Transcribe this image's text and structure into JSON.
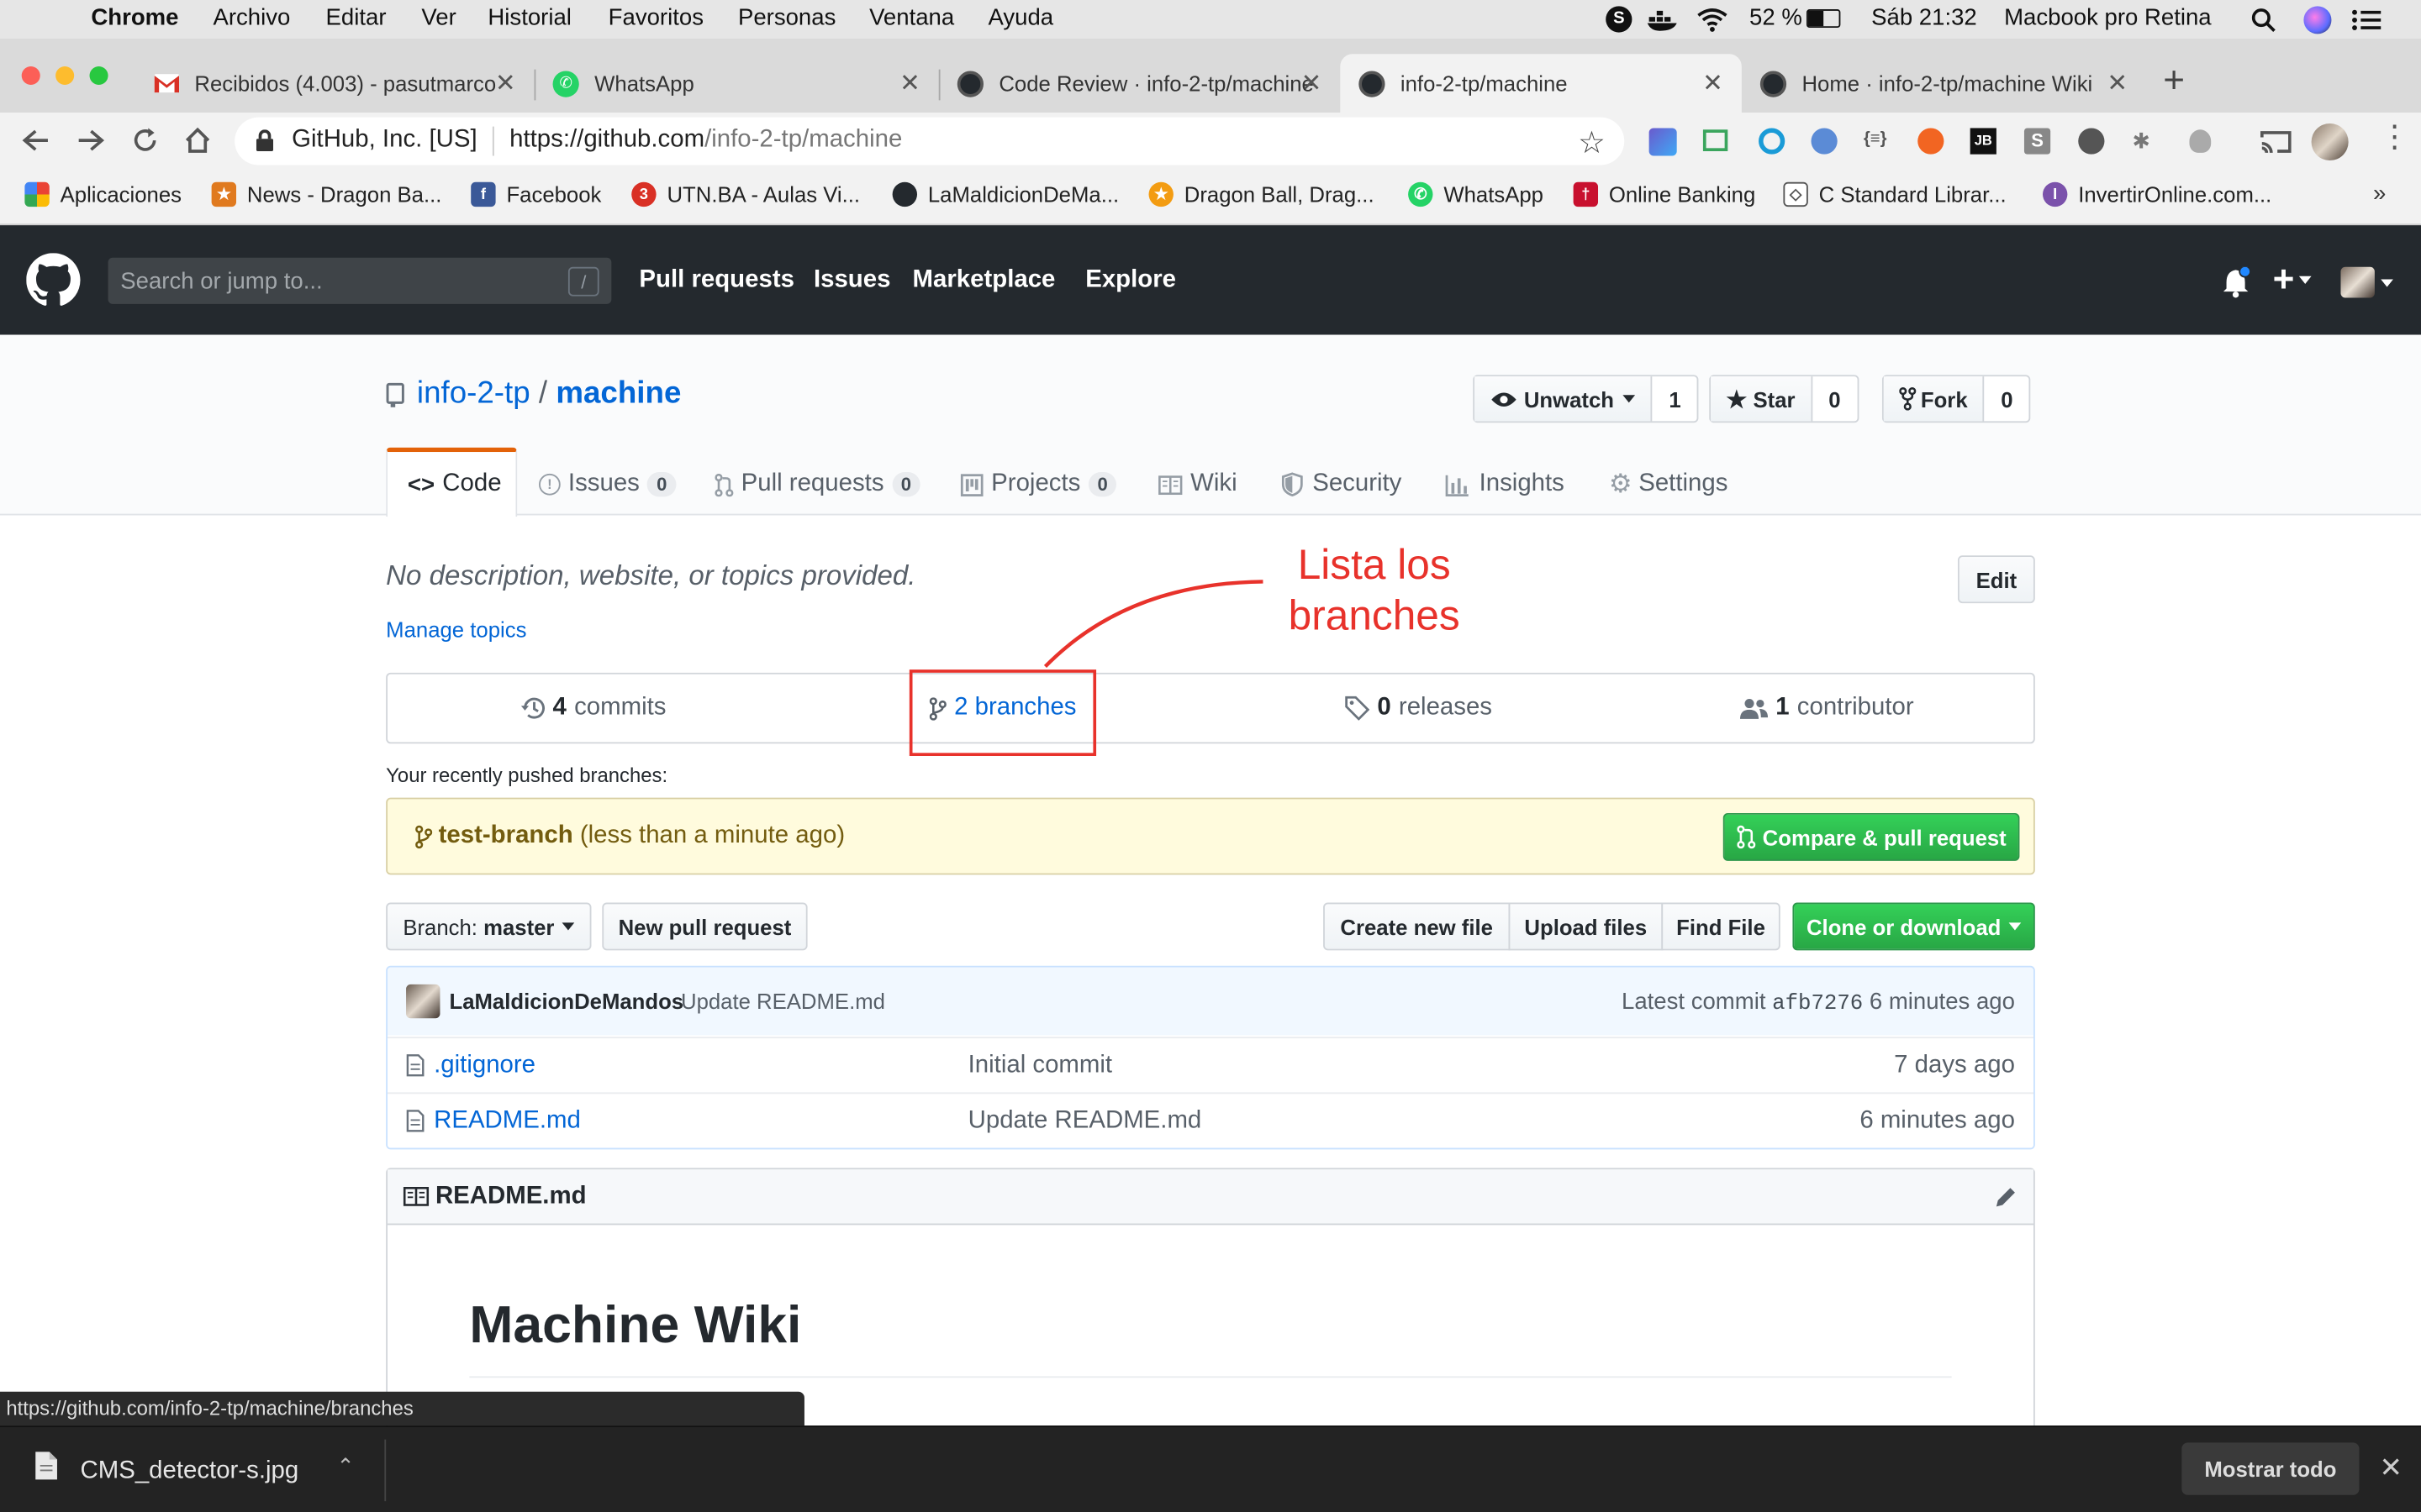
{
  "menubar": {
    "app": "Chrome",
    "items": [
      "Archivo",
      "Editar",
      "Ver",
      "Historial",
      "Favoritos",
      "Personas",
      "Ventana",
      "Ayuda"
    ],
    "battery": "52 %",
    "clock": "Sáb 21:32",
    "machine": "Macbook pro Retina"
  },
  "tabs": [
    {
      "title": "Recibidos (4.003) - pasutmarco",
      "icon": "gmail-icon"
    },
    {
      "title": "WhatsApp",
      "icon": "whatsapp-icon"
    },
    {
      "title": "Code Review · info-2-tp/machine",
      "icon": "github-icon"
    },
    {
      "title": "info-2-tp/machine",
      "icon": "github-icon",
      "active": true
    },
    {
      "title": "Home · info-2-tp/machine Wiki",
      "icon": "github-icon"
    }
  ],
  "omnibox": {
    "site": "GitHub, Inc. [US]",
    "url_host": "https://github.com",
    "url_path": "/info-2-tp/machine"
  },
  "bookmarks": [
    {
      "label": "Aplicaciones",
      "color": "#4285f4"
    },
    {
      "label": "News - Dragon Ba...",
      "color": "#e07a1f"
    },
    {
      "label": "Facebook",
      "color": "#3b5998"
    },
    {
      "label": "UTN.BA - Aulas Vi...",
      "color": "#d93025"
    },
    {
      "label": "LaMaldicionDeMa...",
      "color": "#24292e"
    },
    {
      "label": "Dragon Ball, Drag...",
      "color": "#f39c12"
    },
    {
      "label": "WhatsApp",
      "color": "#25d366"
    },
    {
      "label": "Online Banking",
      "color": "#c8102e"
    },
    {
      "label": "C Standard Librar...",
      "color": "#555555"
    },
    {
      "label": "InvertirOnline.com...",
      "color": "#7b52ab"
    }
  ],
  "github": {
    "search_placeholder": "Search or jump to...",
    "search_key": "/",
    "nav": [
      "Pull requests",
      "Issues",
      "Marketplace",
      "Explore"
    ]
  },
  "repo": {
    "owner": "info-2-tp",
    "sep": "/",
    "name": "machine",
    "watch": {
      "label": "Unwatch",
      "count": "1"
    },
    "star": {
      "label": "Star",
      "count": "0"
    },
    "fork": {
      "label": "Fork",
      "count": "0"
    },
    "tabs": [
      {
        "label": "Code"
      },
      {
        "label": "Issues",
        "count": "0"
      },
      {
        "label": "Pull requests",
        "count": "0"
      },
      {
        "label": "Projects",
        "count": "0"
      },
      {
        "label": "Wiki"
      },
      {
        "label": "Security"
      },
      {
        "label": "Insights"
      },
      {
        "label": "Settings"
      }
    ],
    "description": "No description, website, or topics provided.",
    "manage_topics": "Manage topics",
    "edit": "Edit",
    "summary": {
      "commits_n": "4",
      "commits": "commits",
      "branches": "2 branches",
      "releases_n": "0",
      "releases": "releases",
      "contributors_n": "1",
      "contributors": "contributor"
    },
    "annotation": {
      "line1": "Lista los",
      "line2": "branches",
      "color": "#e8322b"
    },
    "recent_label": "Your recently pushed branches:",
    "recent_branch": "test-branch",
    "recent_time": "(less than a minute ago)",
    "compare_btn": "Compare & pull request",
    "branch_label": "Branch:",
    "branch_value": "master",
    "new_pr": "New pull request",
    "create_file": "Create new file",
    "upload_files": "Upload files",
    "find_file": "Find File",
    "clone": "Clone or download",
    "commit": {
      "author": "LaMaldicionDeMandos",
      "message": "Update README.md",
      "latest": "Latest commit",
      "sha": "afb7276",
      "age": "6 minutes ago"
    },
    "files": [
      {
        "name": ".gitignore",
        "message": "Initial commit",
        "age": "7 days ago"
      },
      {
        "name": "README.md",
        "message": "Update README.md",
        "age": "6 minutes ago"
      }
    ],
    "readme_title": "README.md",
    "readme_heading": "Machine Wiki"
  },
  "status_url": "https://github.com/info-2-tp/machine/branches",
  "download": {
    "file": "CMS_detector-s.jpg",
    "show_all": "Mostrar todo"
  }
}
